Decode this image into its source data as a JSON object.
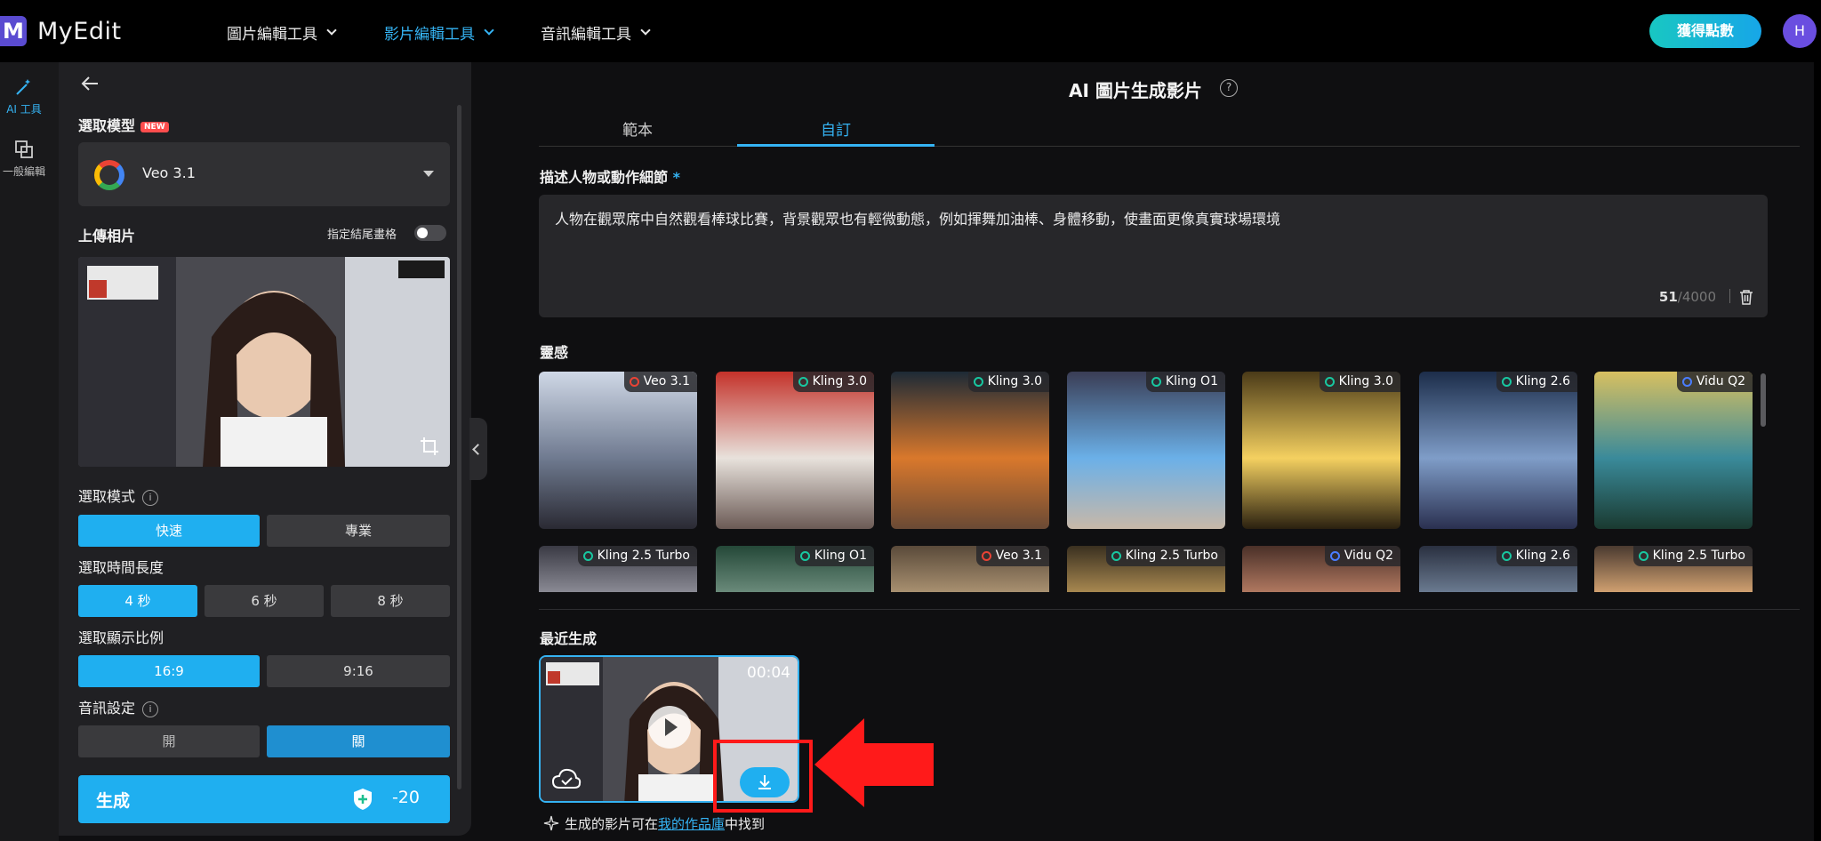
{
  "header": {
    "logo_letter": "M",
    "logo_text": "MyEdit",
    "nav": [
      {
        "label": "圖片編輯工具",
        "active": false
      },
      {
        "label": "影片編輯工具",
        "active": true
      },
      {
        "label": "音訊編輯工具",
        "active": false
      }
    ],
    "credits_button": "獲得點數",
    "avatar_initial": "H"
  },
  "rail": {
    "items": [
      {
        "label": "AI 工具",
        "icon": "magic-wand-icon",
        "active": true
      },
      {
        "label": "一般編輯",
        "icon": "layers-icon",
        "active": false
      }
    ]
  },
  "panel": {
    "model_label": "選取模型",
    "new_badge": "NEW",
    "model_value": "Veo 3.1",
    "upload_label": "上傳相片",
    "end_frame_toggle_label": "指定結尾畫格",
    "end_frame_toggle_on": false,
    "mode_label": "選取模式",
    "mode_options": [
      "快速",
      "專業"
    ],
    "mode_selected": "快速",
    "duration_label": "選取時間長度",
    "duration_options": [
      "4 秒",
      "6 秒",
      "8 秒"
    ],
    "duration_selected": "4 秒",
    "ratio_label": "選取顯示比例",
    "ratio_options": [
      "16:9",
      "9:16"
    ],
    "ratio_selected": "16:9",
    "audio_label": "音訊設定",
    "audio_options": [
      "開",
      "關"
    ],
    "audio_selected": "關",
    "generate_label": "生成",
    "generate_cost": "-20"
  },
  "main": {
    "title": "AI 圖片生成影片",
    "help_icon": "?",
    "tabs": [
      {
        "label": "範本",
        "active": false
      },
      {
        "label": "自訂",
        "active": true
      }
    ],
    "prompt_label": "描述人物或動作細節",
    "required_mark": "*",
    "prompt_text": "人物在觀眾席中自然觀看棒球比賽，背景觀眾也有輕微動態，例如揮舞加油棒、身體移動，使畫面更像真實球場環境",
    "char_count": "51",
    "char_limit": "/4000",
    "inspiration_label": "靈感",
    "inspiration_row1": [
      {
        "model": "Veo 3.1",
        "colors": [
          "#cfd8e6",
          "#6f7a90",
          "#2a2a33"
        ]
      },
      {
        "model": "Kling 3.0",
        "colors": [
          "#c4322a",
          "#e8e2dc",
          "#6b5a55"
        ]
      },
      {
        "model": "Kling 3.0",
        "colors": [
          "#1d2a36",
          "#d9782c",
          "#6a4a35"
        ]
      },
      {
        "model": "Kling O1",
        "colors": [
          "#3a3d55",
          "#6bb0e8",
          "#c8b8a8"
        ]
      },
      {
        "model": "Kling 3.0",
        "colors": [
          "#4a3a18",
          "#f4d060",
          "#2a2010"
        ]
      },
      {
        "model": "Kling 2.6",
        "colors": [
          "#1c2d4a",
          "#7f9dc8",
          "#2a3050"
        ]
      },
      {
        "model": "Vidu Q2",
        "colors": [
          "#d8c060",
          "#3a8a9a",
          "#1a3a30"
        ]
      }
    ],
    "inspiration_row2": [
      {
        "model": "Kling 2.5 Turbo",
        "colors": [
          "#3a3a44",
          "#8a8a94"
        ]
      },
      {
        "model": "Kling O1",
        "colors": [
          "#244838",
          "#6a8a7a"
        ]
      },
      {
        "model": "Veo 3.1",
        "colors": [
          "#5a4a3a",
          "#a89070"
        ]
      },
      {
        "model": "Kling 2.5 Turbo",
        "colors": [
          "#3a3020",
          "#a88850"
        ]
      },
      {
        "model": "Vidu Q2",
        "colors": [
          "#4a3028",
          "#b07860"
        ]
      },
      {
        "model": "Kling 2.6",
        "colors": [
          "#2a3040",
          "#6a7a90"
        ]
      },
      {
        "model": "Kling 2.5 Turbo",
        "colors": [
          "#4a3a30",
          "#d0a070"
        ]
      }
    ],
    "recent_label": "最近生成",
    "recent_duration": "00:04",
    "footer_text_pre": "生成的影片可在",
    "footer_link": "我的作品庫",
    "footer_text_post": "中找到"
  }
}
